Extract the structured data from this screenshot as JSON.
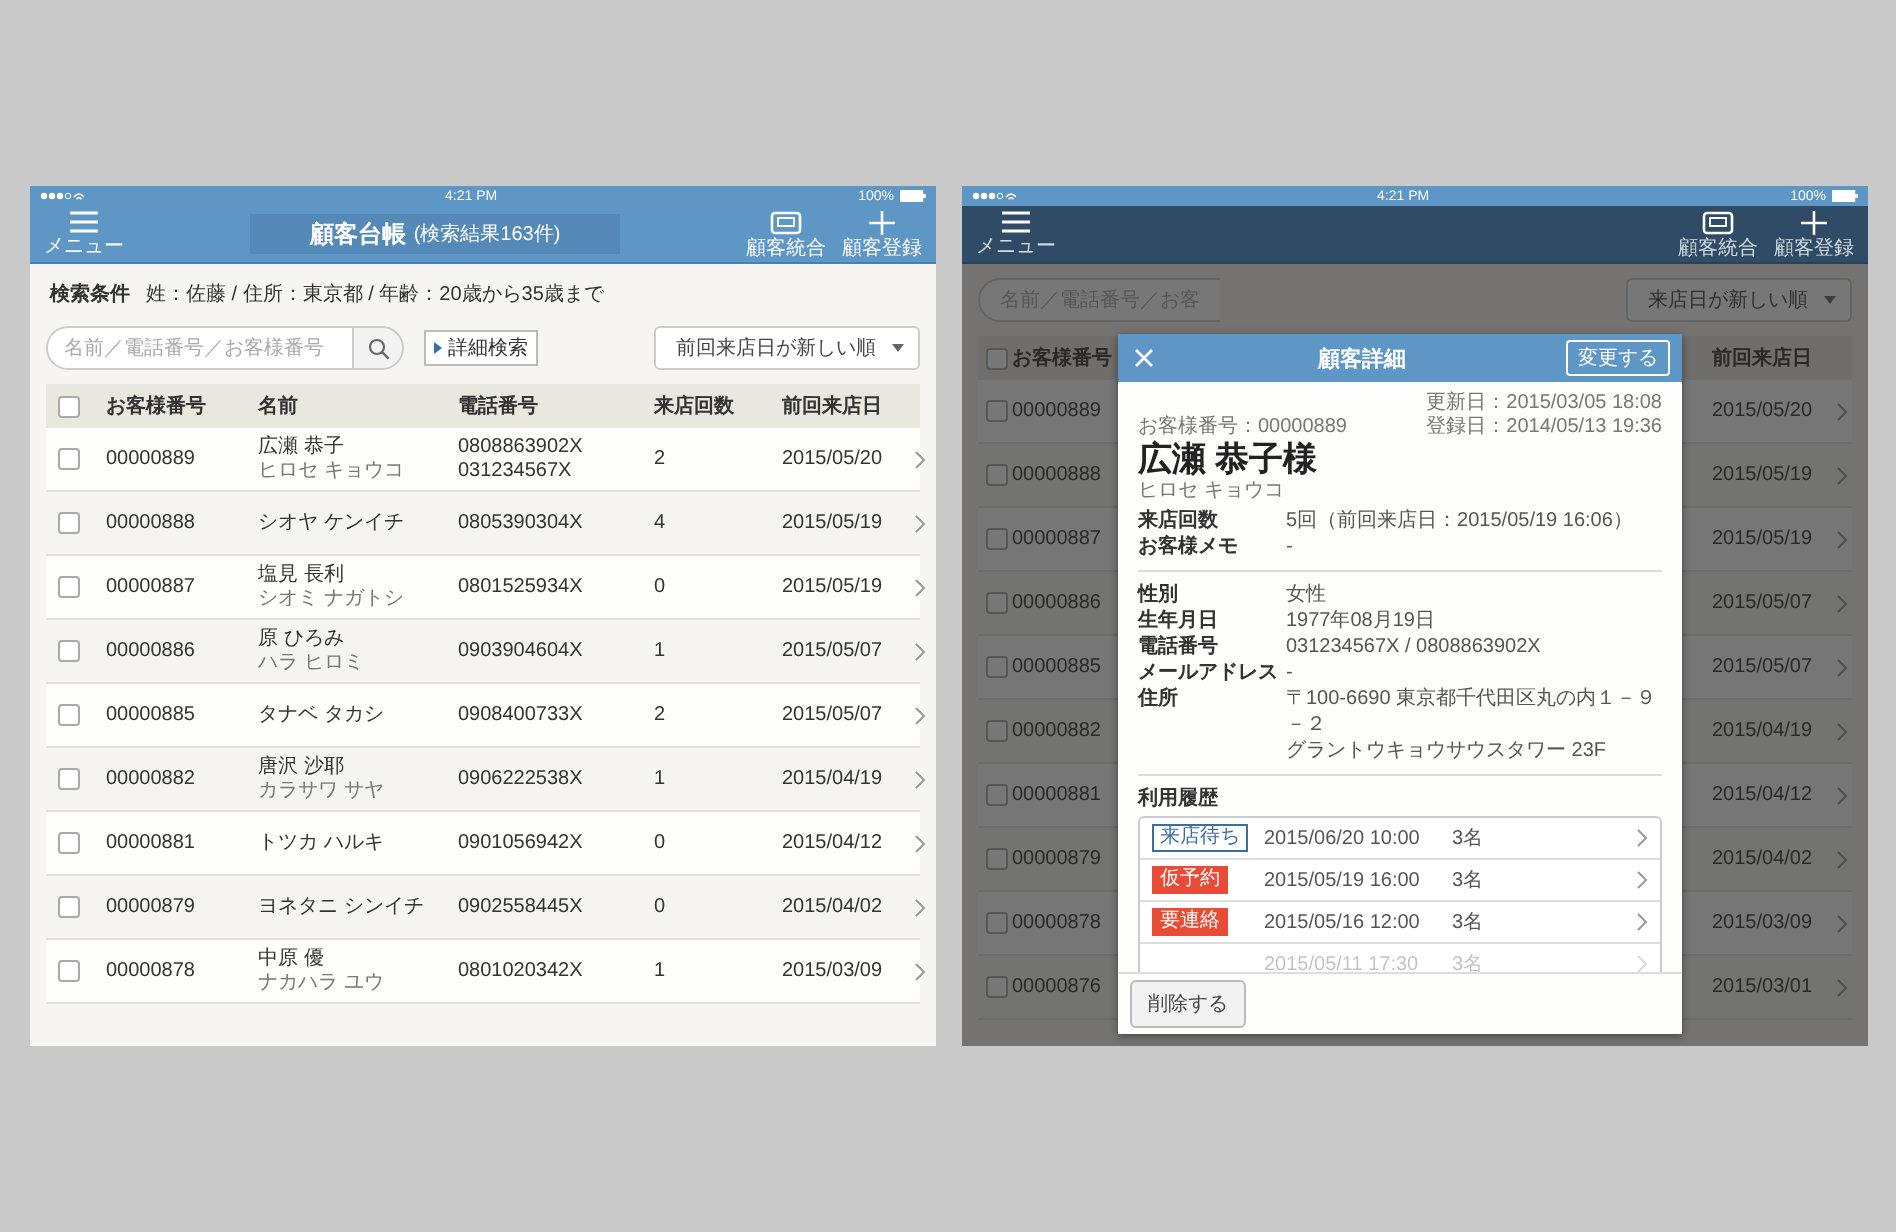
{
  "list_screen": {
    "status_bar": {
      "time": "4:21 PM",
      "battery": "100%"
    },
    "nav_bar": {
      "menu_label": "メニュー",
      "title": "顧客台帳",
      "subtitle": "(検索結果163件)",
      "actions": [
        {
          "kind": "merge",
          "label": "顧客統合"
        },
        {
          "kind": "add",
          "label": "顧客登録"
        }
      ]
    },
    "search_conditions": {
      "label": "検索条件",
      "text": "姓：佐藤 / 住所：東京都 / 年齢：20歳から35歳まで"
    },
    "search": {
      "placeholder": "名前／電話番号／お客様番号"
    },
    "advanced_search_button": "詳細検索",
    "sort": {
      "value": "前回来店日が新しい順"
    },
    "table": {
      "select_all_checked": false,
      "columns": [
        "お客様番号",
        "名前",
        "電話番号",
        "来店回数",
        "前回来店日"
      ],
      "rows": [
        {
          "checked": false,
          "number": "00000889",
          "name": "広瀬 恭子",
          "reading": "ヒロセ キョウコ",
          "phones": [
            "0808863902X",
            "031234567X"
          ],
          "visits": "2",
          "last_visit": "2015/05/20"
        },
        {
          "checked": false,
          "number": "00000888",
          "name": "シオヤ ケンイチ",
          "phones": [
            "0805390304X"
          ],
          "visits": "4",
          "last_visit": "2015/05/19"
        },
        {
          "checked": false,
          "number": "00000887",
          "name": "塩見 長利",
          "reading": "シオミ ナガトシ",
          "phones": [
            "0801525934X"
          ],
          "visits": "0",
          "last_visit": "2015/05/19"
        },
        {
          "checked": false,
          "number": "00000886",
          "name": "原 ひろみ",
          "reading": "ハラ ヒロミ",
          "phones": [
            "0903904604X"
          ],
          "visits": "1",
          "last_visit": "2015/05/07"
        },
        {
          "checked": false,
          "number": "00000885",
          "name": "タナベ タカシ",
          "phones": [
            "0908400733X"
          ],
          "visits": "2",
          "last_visit": "2015/05/07"
        },
        {
          "checked": false,
          "number": "00000882",
          "name": "唐沢 沙耶",
          "reading": "カラサワ サヤ",
          "phones": [
            "0906222538X"
          ],
          "visits": "1",
          "last_visit": "2015/04/19"
        },
        {
          "checked": false,
          "number": "00000881",
          "name": "トツカ ハルキ",
          "phones": [
            "0901056942X"
          ],
          "visits": "0",
          "last_visit": "2015/04/12"
        },
        {
          "checked": false,
          "number": "00000879",
          "name": "ヨネタニ シンイチ",
          "phones": [
            "0902558445X"
          ],
          "visits": "0",
          "last_visit": "2015/04/02"
        },
        {
          "checked": false,
          "number": "00000878",
          "name": "中原 優",
          "reading": "ナカハラ ユウ",
          "phones": [
            "0801020342X"
          ],
          "visits": "1",
          "last_visit": "2015/03/09"
        }
      ]
    }
  },
  "detail_screen": {
    "status_bar": {
      "time": "4:21 PM",
      "battery": "100%"
    },
    "nav_bar": {
      "menu_label": "メニュー",
      "actions": [
        {
          "kind": "merge",
          "label": "顧客統合"
        },
        {
          "kind": "add",
          "label": "顧客登録"
        }
      ]
    },
    "search": {
      "placeholder": "名前／電話番号／お客"
    },
    "sort": {
      "value": "来店日が新しい順"
    },
    "table": {
      "select_all_checked": false,
      "columns": [
        "お客様番号",
        "前回来店日"
      ],
      "rows": [
        {
          "checked": false,
          "number": "00000889",
          "last_visit": "2015/05/20"
        },
        {
          "checked": false,
          "number": "00000888",
          "last_visit": "2015/05/19"
        },
        {
          "checked": false,
          "number": "00000887",
          "last_visit": "2015/05/19"
        },
        {
          "checked": false,
          "number": "00000886",
          "last_visit": "2015/05/07"
        },
        {
          "checked": false,
          "number": "00000885",
          "last_visit": "2015/05/07"
        },
        {
          "checked": false,
          "number": "00000882",
          "last_visit": "2015/04/19"
        },
        {
          "checked": false,
          "number": "00000881",
          "last_visit": "2015/04/12"
        },
        {
          "checked": false,
          "number": "00000879",
          "last_visit": "2015/04/02"
        },
        {
          "checked": false,
          "number": "00000878",
          "last_visit": "2015/03/09"
        },
        {
          "checked": false,
          "number": "00000876",
          "last_visit": "2015/03/01"
        }
      ]
    },
    "modal": {
      "title": "顧客詳細",
      "edit_button": "変更する",
      "updated": "更新日：2015/03/05 18:08",
      "registered": "登録日：2014/05/13 19:36",
      "customer_number": "お客様番号：00000889",
      "name": "広瀬 恭子様",
      "reading": "ヒロセ キョウコ",
      "summary": [
        {
          "label": "来店回数",
          "value": "5回（前回来店日：2015/05/19 16:06）"
        },
        {
          "label": "お客様メモ",
          "value": "-"
        }
      ],
      "profile": [
        {
          "label": "性別",
          "lines": [
            "女性"
          ]
        },
        {
          "label": "生年月日",
          "lines": [
            "1977年08月19日"
          ]
        },
        {
          "label": "電話番号",
          "lines": [
            "031234567X / 0808863902X"
          ]
        },
        {
          "label": "メールアドレス",
          "lines": [
            "-"
          ]
        },
        {
          "label": "住所",
          "lines": [
            "〒100-6690 東京都千代田区丸の内１－９－２",
            "グラントウキョウサウスタワー 23F"
          ]
        }
      ],
      "history_label": "利用履歴",
      "history": [
        {
          "status": "来店待ち",
          "kind": "outline",
          "datetime": "2015/06/20 10:00",
          "party": "3名",
          "faded": false
        },
        {
          "status": "仮予約",
          "kind": "alert",
          "datetime": "2015/05/19 16:00",
          "party": "3名",
          "faded": false
        },
        {
          "status": "要連絡",
          "kind": "alert",
          "datetime": "2015/05/16 12:00",
          "party": "3名",
          "faded": false
        },
        {
          "datetime": "2015/05/11 17:30",
          "party": "3名",
          "faded": true
        }
      ],
      "delete_button": "削除する"
    }
  }
}
